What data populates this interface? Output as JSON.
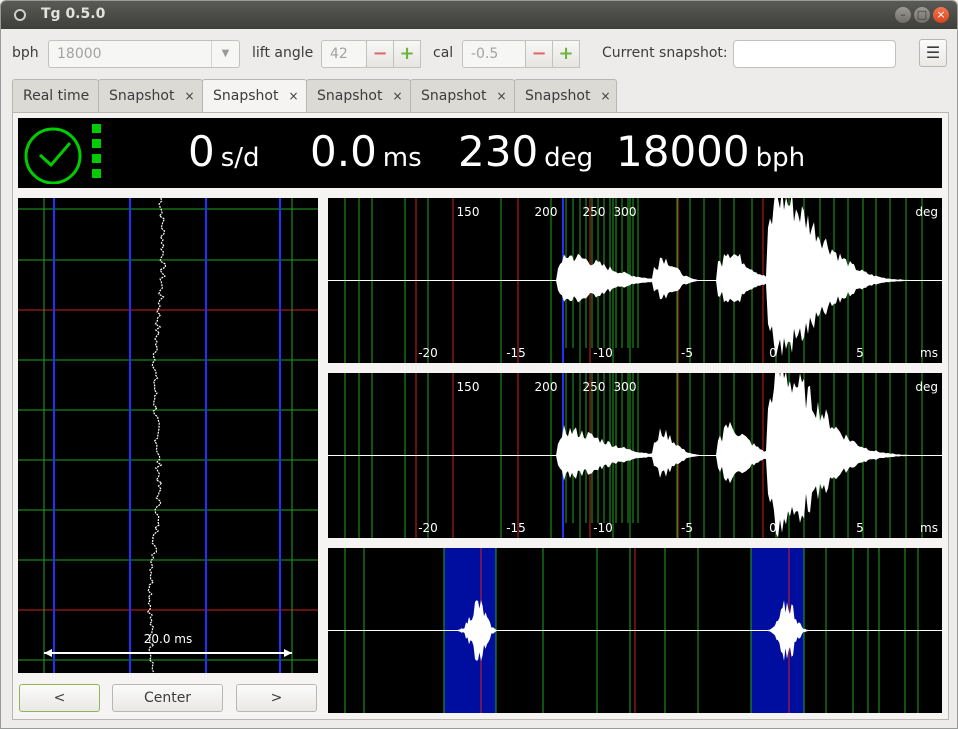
{
  "window": {
    "title": "Tg 0.5.0"
  },
  "toolbar": {
    "bph_label": "bph",
    "bph_value": "18000",
    "lift_angle_label": "lift angle",
    "lift_angle_value": "42",
    "cal_label": "cal",
    "cal_value": "-0.5",
    "snapshot_label": "Current snapshot:",
    "snapshot_name": "",
    "menu_icon": "hamburger-menu-icon"
  },
  "tabs": [
    {
      "label": "Real time",
      "closable": false,
      "active": false
    },
    {
      "label": "Snapshot",
      "closable": true,
      "active": false
    },
    {
      "label": "Snapshot",
      "closable": true,
      "active": true
    },
    {
      "label": "Snapshot",
      "closable": true,
      "active": false
    },
    {
      "label": "Snapshot",
      "closable": true,
      "active": false
    },
    {
      "label": "Snapshot",
      "closable": true,
      "active": false
    }
  ],
  "close_glyph": "×",
  "status": {
    "rate_value": "0",
    "rate_unit": "s/d",
    "beat_error_value": "0.0",
    "beat_error_unit": "ms",
    "amplitude_value": "230",
    "amplitude_unit": "deg",
    "bph_value": "18000",
    "bph_unit": "bph",
    "signal_level": 4,
    "signal_max": 4,
    "lock_icon": "clock-check-icon",
    "accent_color": "#00cc00"
  },
  "paperstrip": {
    "scale_label": "20.0 ms"
  },
  "scope": {
    "deg_ticks": [
      "150",
      "200",
      "250",
      "300"
    ],
    "deg_unit": "deg",
    "ms_ticks": [
      "-20",
      "-15",
      "-10",
      "-5",
      "0",
      "5"
    ],
    "ms_unit": "ms"
  },
  "buttons": {
    "prev": "<",
    "center": "Center",
    "next": ">"
  }
}
